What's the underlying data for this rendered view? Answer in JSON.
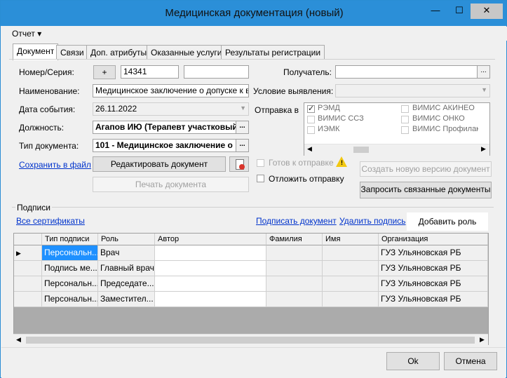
{
  "window": {
    "title": "Медицинская документация (новый)",
    "minimize": "—",
    "maximize": "☐",
    "close": "✕"
  },
  "menu": {
    "report": "Отчет ▾"
  },
  "tabs": [
    "Документ",
    "Связи",
    "Доп. атрибуты",
    "Оказанные услуги",
    "Результаты регистрации"
  ],
  "form": {
    "number_label": "Номер/Серия:",
    "plus": "+",
    "number_value": "14341",
    "series_value": "",
    "name_label": "Наименование:",
    "name_value": "Медицинское заключение о допуске к вып",
    "date_label": "Дата события:",
    "date_value": "26.11.2022",
    "position_label": "Должность:",
    "position_value": "Агапов ИЮ (Терапевт участковый)",
    "doctype_label": "Тип документа:",
    "doctype_value": "101 - Медицинское заключение о ",
    "recipient_label": "Получатель:",
    "recipient_value": "",
    "condition_label": "Условие выявления:",
    "condition_value": "",
    "send_to_label": "Отправка в",
    "save_link": "Сохранить в файл",
    "edit_button": "Редактировать документ",
    "print_button": "Печать документа",
    "ready_label": "Готов к отправке",
    "postpone_label": "Отложить отправку",
    "new_version_button": "Создать новую версию документ",
    "request_button": "Запросить связанные документы",
    "ellipsis": "..."
  },
  "send_targets": [
    {
      "label": "РЭМД",
      "checked": true
    },
    {
      "label": "ВИМИС АКИНЕО",
      "checked": false
    },
    {
      "label": "ВИМИС ССЗ",
      "checked": false
    },
    {
      "label": "ВИМИС ОНКО",
      "checked": false
    },
    {
      "label": "ИЭМК",
      "checked": false
    },
    {
      "label": "ВИМИС Профилактика",
      "checked": false
    }
  ],
  "signatures": {
    "group_label": "Подписи",
    "all_certs": "Все сертификаты",
    "sign_link": "Подписать документ",
    "delete_link": "Удалить подпись",
    "add_role": "Добавить роль",
    "columns": [
      "Тип подписи",
      "Роль",
      "Автор",
      "Фамилия",
      "Имя",
      "Организация"
    ],
    "rows": [
      {
        "type": "Персональн...",
        "role": "Врач",
        "author": "",
        "last": "",
        "first": "",
        "org": "ГУЗ Ульяновская РБ"
      },
      {
        "type": "Подпись ме...",
        "role": "Главный врач",
        "author": "",
        "last": "",
        "first": "",
        "org": "ГУЗ Ульяновская РБ"
      },
      {
        "type": "Персональн...",
        "role": "Председате...",
        "author": "",
        "last": "",
        "first": "",
        "org": "ГУЗ Ульяновская РБ"
      },
      {
        "type": "Персональн...",
        "role": "Заместител...",
        "author": "",
        "last": "",
        "first": "",
        "org": "ГУЗ Ульяновская РБ"
      }
    ]
  },
  "footer": {
    "ok": "Ok",
    "cancel": "Отмена"
  },
  "colors": {
    "titlebar": "#2b8fd8",
    "link": "#0033cc",
    "selection": "#1e90ff"
  }
}
